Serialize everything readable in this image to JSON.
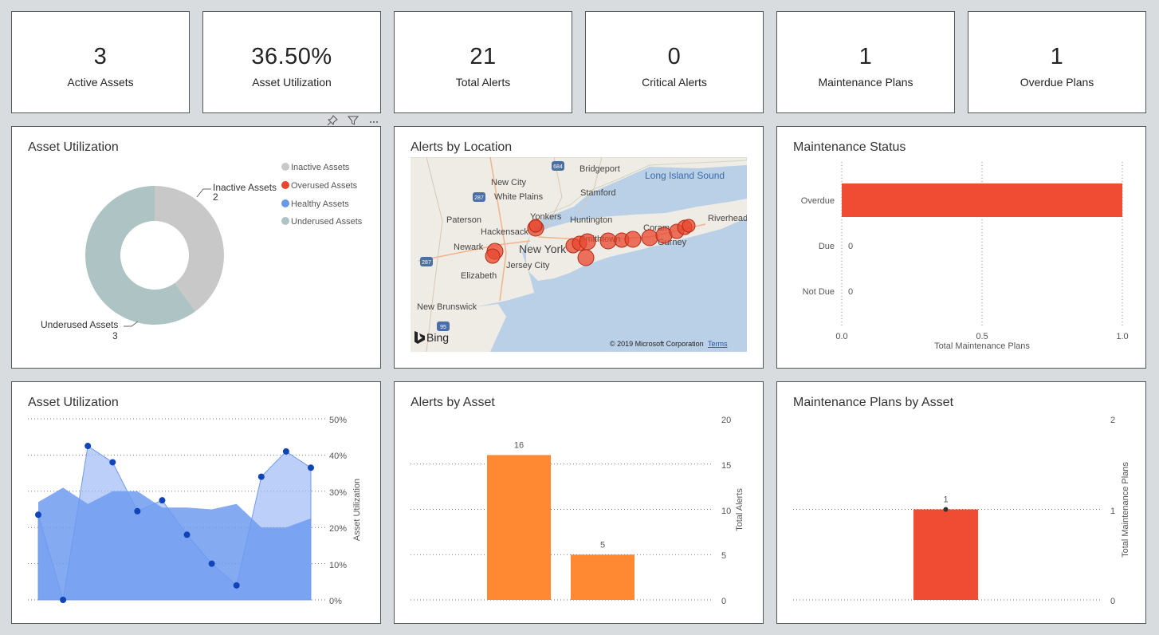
{
  "kpis": [
    {
      "value": "3",
      "label": "Active Assets"
    },
    {
      "value": "36.50%",
      "label": "Asset Utilization"
    },
    {
      "value": "21",
      "label": "Total Alerts"
    },
    {
      "value": "0",
      "label": "Critical Alerts"
    },
    {
      "value": "1",
      "label": "Maintenance Plans"
    },
    {
      "value": "1",
      "label": "Overdue Plans"
    }
  ],
  "visual_header": {
    "pin_icon": "pin-icon",
    "filter_icon": "filter-icon",
    "more_icon": "more-options-icon"
  },
  "donut": {
    "title": "Asset Utilization",
    "legend": [
      {
        "name": "Inactive Assets",
        "color": "#c8c8c8"
      },
      {
        "name": "Overused Assets",
        "color": "#e8472f"
      },
      {
        "name": "Healthy Assets",
        "color": "#6a98e8"
      },
      {
        "name": "Underused Assets",
        "color": "#aec4c4"
      }
    ],
    "label_inactive_name": "Inactive Assets",
    "label_inactive_value": "2",
    "label_underused_name": "Underused Assets",
    "label_underused_value": "3"
  },
  "map": {
    "title": "Alerts by Location",
    "places": [
      "Bridgeport",
      "Long Island Sound",
      "New City",
      "White Plains",
      "Stamford",
      "Paterson",
      "Yonkers",
      "Huntington",
      "Riverhead",
      "Hackensack",
      "Coram",
      "Newark",
      "New York",
      "Smithtown",
      "Gurney",
      "Jersey City",
      "Elizabeth",
      "New Brunswick"
    ],
    "roads": [
      "684",
      "287",
      "287",
      "95"
    ],
    "bing": "Bing",
    "copyright": "© 2019 Microsoft Corporation",
    "terms": "Terms"
  },
  "maintenance_status": {
    "title": "Maintenance Status",
    "xlabel": "Total Maintenance Plans",
    "ticks": [
      "0.0",
      "0.5",
      "1.0"
    ]
  },
  "area": {
    "title": "Asset Utilization",
    "ylabel": "Asset Utilization",
    "ticks": [
      "50%",
      "40%",
      "30%",
      "20%",
      "10%",
      "0%"
    ]
  },
  "alerts_by_asset": {
    "title": "Alerts by Asset",
    "ylabel": "Total Alerts",
    "ticks": [
      "20",
      "15",
      "10",
      "5",
      "0"
    ]
  },
  "plans_by_asset": {
    "title": "Maintenance Plans by Asset",
    "ylabel": "Total Maintenance Plans",
    "ticks": [
      "2",
      "1",
      "0"
    ]
  },
  "chart_data": [
    {
      "type": "pie",
      "title": "Asset Utilization",
      "categories": [
        "Inactive Assets",
        "Overused Assets",
        "Healthy Assets",
        "Underused Assets"
      ],
      "values": [
        2,
        0,
        0,
        3
      ],
      "colors": [
        "#c8c8c8",
        "#e8472f",
        "#6a98e8",
        "#aec4c4"
      ],
      "legend": "top-right",
      "donut": true
    },
    {
      "type": "bar",
      "orientation": "horizontal",
      "title": "Maintenance Status",
      "categories": [
        "Overdue",
        "Due",
        "Not Due"
      ],
      "values": [
        1,
        0,
        0
      ],
      "data_labels": [
        "",
        "0",
        "0"
      ],
      "xlabel": "Total Maintenance Plans",
      "xlim": [
        0,
        1
      ],
      "color": "#f04b33"
    },
    {
      "type": "area",
      "title": "Asset Utilization",
      "ylabel": "Asset Utilization",
      "ylim": [
        0,
        50
      ],
      "x": [
        1,
        2,
        3,
        4,
        5,
        6,
        7,
        8,
        9,
        10,
        11,
        12
      ],
      "series": [
        {
          "values": [
            27,
            31,
            26.5,
            30,
            30,
            25.5,
            25.5,
            25,
            26.5,
            20,
            20,
            22.5
          ],
          "color": "#6f9bf0"
        },
        {
          "values": [
            23.5,
            0,
            42.5,
            38,
            24.5,
            27.5,
            18,
            10,
            4,
            34,
            41,
            36.5
          ],
          "color": "#9fbaf5",
          "markers": true
        }
      ]
    },
    {
      "type": "bar",
      "title": "Alerts by Asset",
      "categories": [
        "",
        ""
      ],
      "values": [
        16,
        5
      ],
      "ylabel": "Total Alerts",
      "ylim": [
        0,
        20
      ],
      "color": "#ff8833"
    },
    {
      "type": "bar",
      "title": "Maintenance Plans by Asset",
      "categories": [
        ""
      ],
      "values": [
        1
      ],
      "ylabel": "Total Maintenance Plans",
      "ylim": [
        0,
        2
      ],
      "color": "#f04b33"
    }
  ]
}
